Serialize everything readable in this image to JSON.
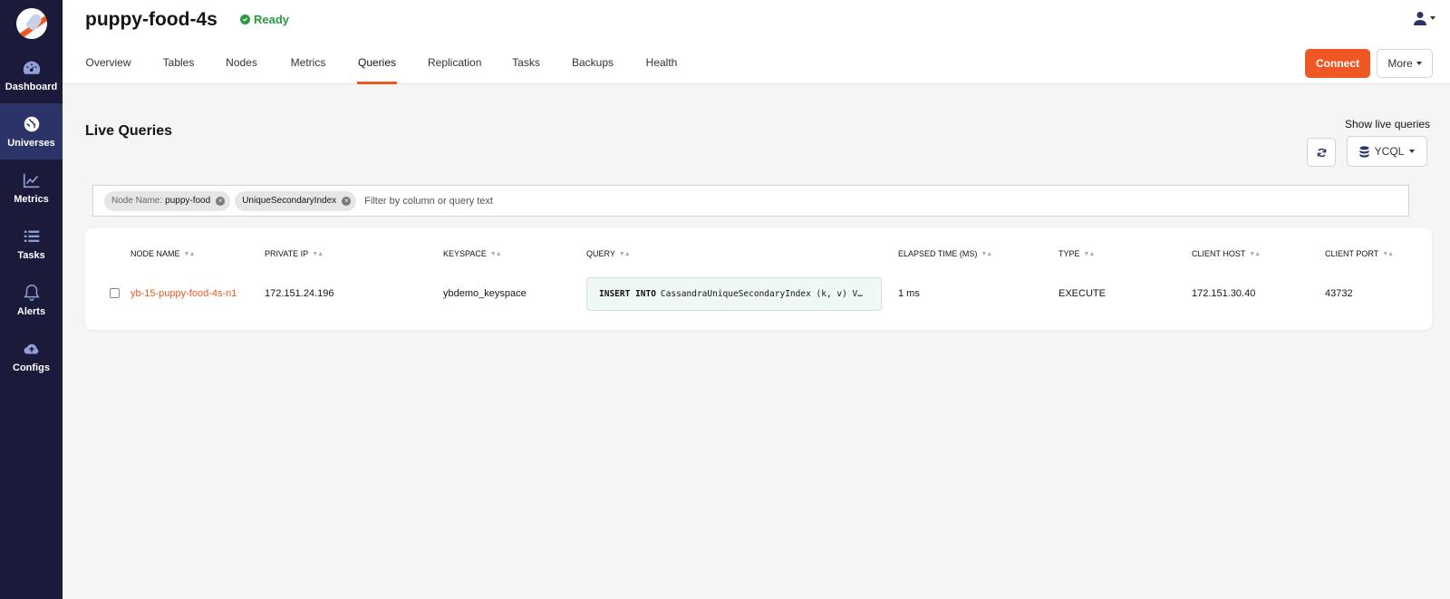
{
  "sidebar": {
    "items": [
      {
        "label": "Dashboard",
        "icon": "dashboard-icon"
      },
      {
        "label": "Universes",
        "icon": "globe-icon",
        "active": true
      },
      {
        "label": "Metrics",
        "icon": "chart-line-icon"
      },
      {
        "label": "Tasks",
        "icon": "list-icon"
      },
      {
        "label": "Alerts",
        "icon": "bell-icon"
      },
      {
        "label": "Configs",
        "icon": "cloud-upload-icon"
      }
    ]
  },
  "header": {
    "title": "puppy-food-4s",
    "status": "Ready",
    "tabs": [
      "Overview",
      "Tables",
      "Nodes",
      "Metrics",
      "Queries",
      "Replication",
      "Tasks",
      "Backups",
      "Health"
    ],
    "active_tab": "Queries",
    "connect_label": "Connect",
    "more_label": "More"
  },
  "main": {
    "section_title": "Live Queries",
    "show_live_label": "Show live queries",
    "query_type": "YCQL",
    "filters": [
      {
        "key": "Node Name:",
        "value": "puppy-food"
      },
      {
        "key": "",
        "value": "UniqueSecondaryIndex"
      }
    ],
    "filter_placeholder": "Filter by column or query text"
  },
  "table": {
    "columns": [
      "NODE NAME",
      "PRIVATE IP",
      "KEYSPACE",
      "QUERY",
      "ELAPSED TIME (MS)",
      "TYPE",
      "CLIENT HOST",
      "CLIENT PORT"
    ],
    "rows": [
      {
        "node_name": "yb-15-puppy-food-4s-n1",
        "private_ip": "172.151.24.196",
        "keyspace": "ybdemo_keyspace",
        "query_keyword": "INSERT INTO",
        "query_rest": "CassandraUniqueSecondaryIndex (k, v) V…",
        "elapsed": "1 ms",
        "type": "EXECUTE",
        "client_host": "172.151.30.40",
        "client_port": "43732"
      }
    ]
  },
  "colors": {
    "accent": "#ef5824",
    "sidebar_bg": "#1c1a3b",
    "sidebar_active": "#2b3466",
    "status_green": "#289b42"
  }
}
